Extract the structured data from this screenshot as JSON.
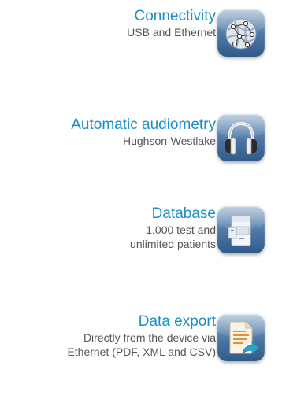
{
  "features": [
    {
      "title": "Connectivity",
      "subtitle_lines": [
        "USB and Ethernet"
      ],
      "icon": "globe-network-icon"
    },
    {
      "title": "Automatic audiometry",
      "subtitle_lines": [
        "Hughson-Westlake"
      ],
      "icon": "headphones-icon"
    },
    {
      "title": "Database",
      "subtitle_lines": [
        "1,000 test and",
        "unlimited patients"
      ],
      "icon": "filing-cabinet-icon"
    },
    {
      "title": "Data export",
      "subtitle_lines": [
        "Directly from the device via",
        "Ethernet (PDF, XML and CSV)"
      ],
      "icon": "document-export-icon"
    }
  ],
  "colors": {
    "title": "#1a8fc4",
    "subtitle": "#555555",
    "tile": "#4f78a5"
  }
}
